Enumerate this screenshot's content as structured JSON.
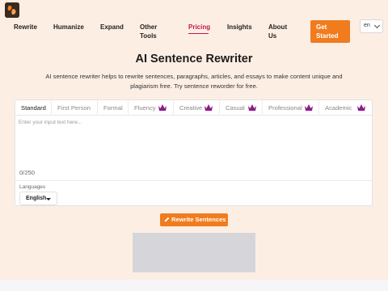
{
  "nav": {
    "items": [
      {
        "label": "Rewrite",
        "active": false
      },
      {
        "label": "Humanize",
        "active": false
      },
      {
        "label": "Expand",
        "active": false
      },
      {
        "label": "Other\nTools",
        "active": false
      },
      {
        "label": "Pricing",
        "active": true
      },
      {
        "label": "Insights",
        "active": false
      },
      {
        "label": "About\nUs",
        "active": false
      }
    ],
    "cta_label": "Get\nStarted",
    "language": "en"
  },
  "hero": {
    "title": "AI Sentence Rewriter",
    "description": "AI sentence rewriter helps to rewrite sentences, paragraphs, articles, and essays to make content unique and plagiarism free. Try sentence reworder for free."
  },
  "editor": {
    "tabs": [
      {
        "label": "Standard",
        "premium": false,
        "active": true
      },
      {
        "label": "First Person",
        "premium": false,
        "active": false
      },
      {
        "label": "Formal",
        "premium": false,
        "active": false
      },
      {
        "label": "Fluency",
        "premium": true,
        "active": false
      },
      {
        "label": "Creative",
        "premium": true,
        "active": false
      },
      {
        "label": "Casual",
        "premium": true,
        "active": false
      },
      {
        "label": "Professional",
        "premium": true,
        "active": false
      },
      {
        "label": "Academic",
        "premium": true,
        "active": false
      }
    ],
    "placeholder": "Enter your input text here...",
    "counter": "0/250",
    "languages_label": "Languages",
    "language_value": "English"
  },
  "action": {
    "rewrite_label": "Rewrite Sentences"
  },
  "colors": {
    "accent": "#f07c1e",
    "active_nav": "#c0174f",
    "crown": "#8e1b8a",
    "background": "#fdeee4"
  }
}
